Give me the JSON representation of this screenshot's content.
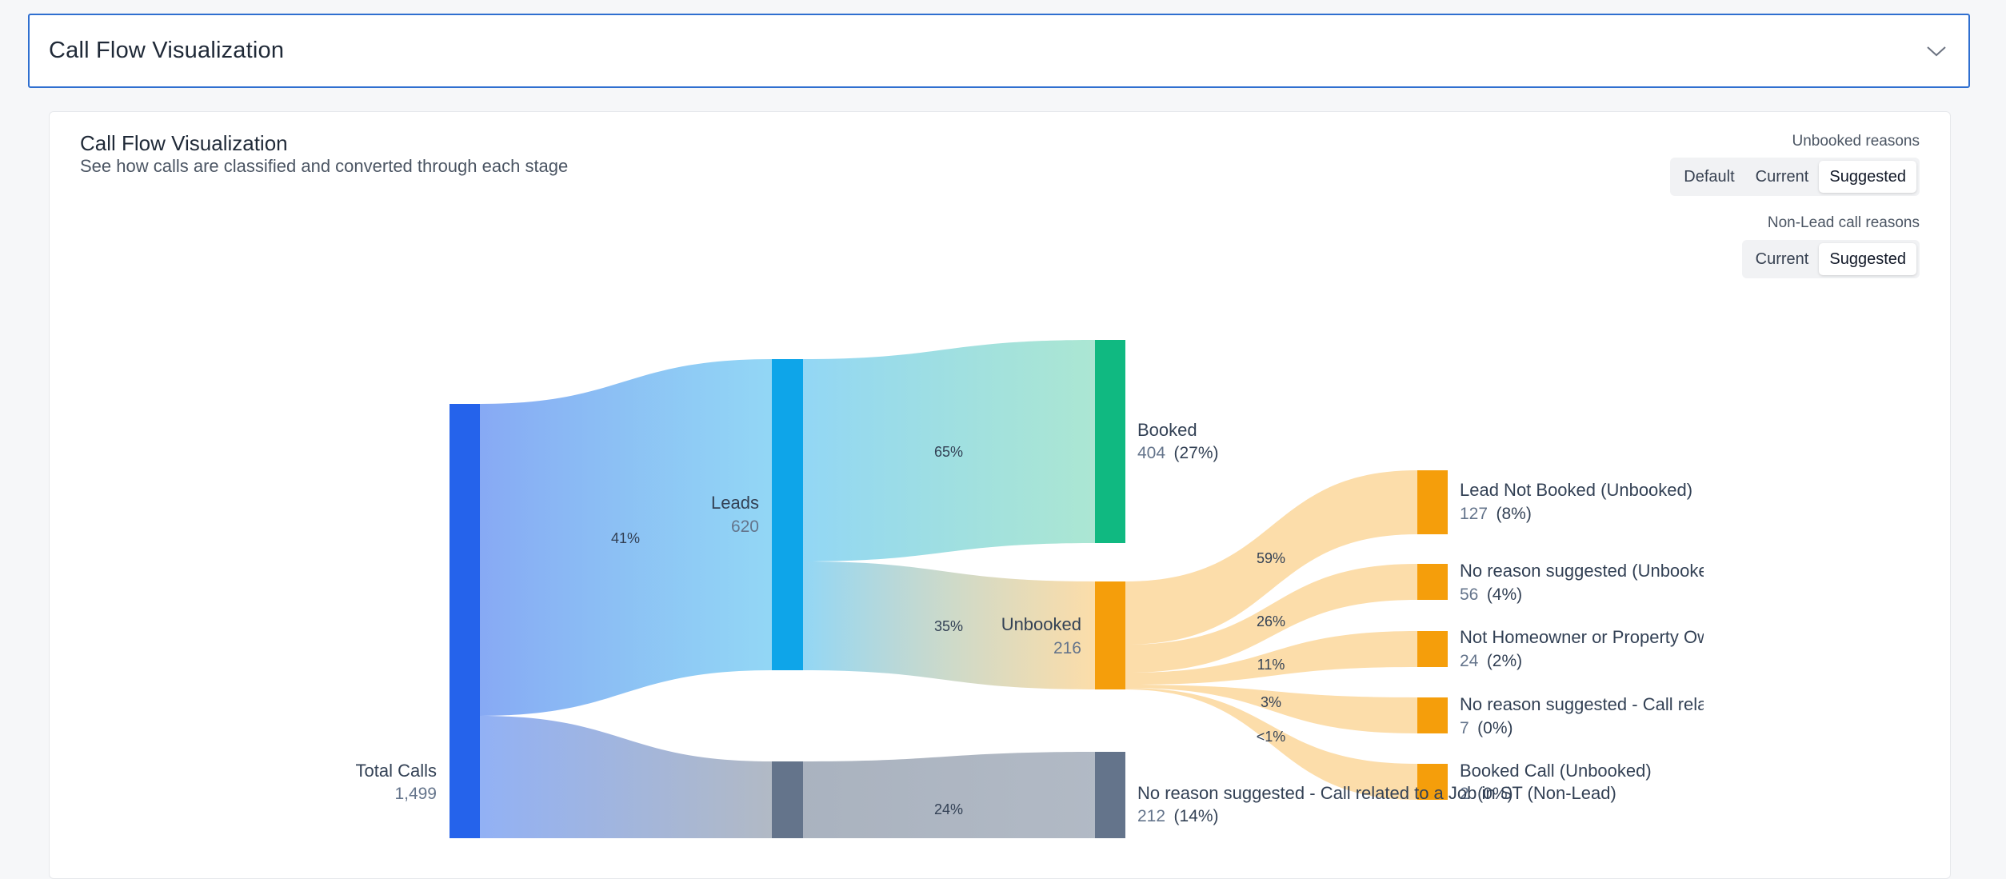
{
  "accordion": {
    "title": "Call Flow Visualization",
    "icon": "chevron-down-icon"
  },
  "card": {
    "title": "Call Flow Visualization",
    "subtitle": "See how calls are classified and converted through each stage"
  },
  "unbooked_reasons": {
    "label": "Unbooked reasons",
    "options": [
      "Default",
      "Current",
      "Suggested"
    ],
    "selected": "Suggested"
  },
  "nonlead_reasons": {
    "label": "Non-Lead call reasons",
    "options": [
      "Current",
      "Suggested"
    ],
    "selected": "Suggested"
  },
  "sankey": {
    "nodes": {
      "total": {
        "name": "Total Calls",
        "value": "1,499",
        "color": "#2563eb"
      },
      "leads": {
        "name": "Leads",
        "value": "620",
        "color": "#0ea5e9"
      },
      "booked": {
        "name": "Booked",
        "value": "404",
        "pct": "(27%)",
        "color": "#10b981"
      },
      "unbooked": {
        "name": "Unbooked",
        "value": "216",
        "color": "#f59e0b"
      },
      "nonlead_stage": {
        "color": "#64748b"
      },
      "nonlead": {
        "name": "No reason suggested - Call related to a Job in ST (Non-Lead)",
        "value": "212",
        "pct": "(14%)",
        "color": "#64748b"
      },
      "r1": {
        "name": "Lead Not Booked (Unbooked)",
        "value": "127",
        "pct": "(8%)",
        "color": "#f59e0b"
      },
      "r2": {
        "name": "No reason suggested (Unbooked)",
        "value": "56",
        "pct": "(4%)",
        "color": "#f59e0b"
      },
      "r3": {
        "name": "Not Homeowner or Property Owner",
        "value": "24",
        "pct": "(2%)",
        "color": "#f59e0b"
      },
      "r4": {
        "name": "No reason suggested - Call related",
        "value": "7",
        "pct": "(0%)",
        "color": "#f59e0b"
      },
      "r5": {
        "name": "Booked Call (Unbooked)",
        "value": "2",
        "pct": "(0%)",
        "color": "#f59e0b"
      }
    },
    "links": {
      "total_leads": "41%",
      "leads_booked": "65%",
      "leads_unbooked": "35%",
      "nonlead": "24%",
      "u_r1": "59%",
      "u_r2": "26%",
      "u_r3": "11%",
      "u_r4": "3%",
      "u_r5": "<1%"
    }
  }
}
